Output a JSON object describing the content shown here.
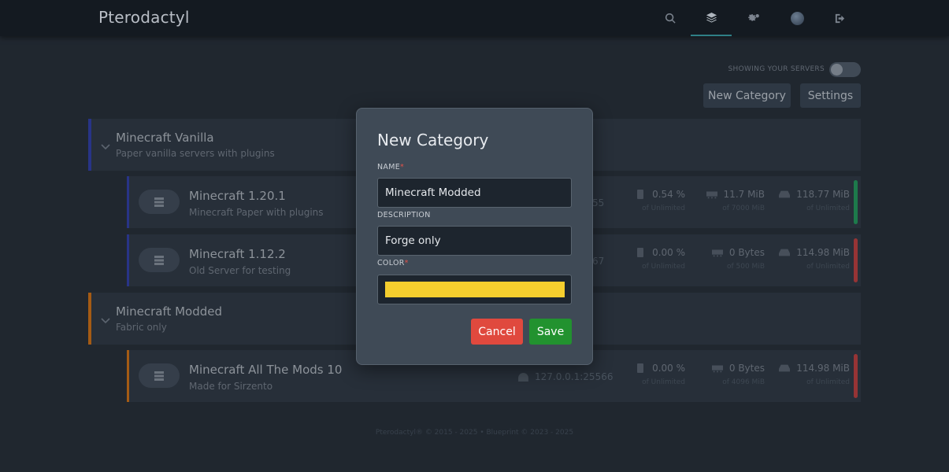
{
  "brand": "Pterodactyl",
  "nav": {
    "icons": [
      "search-icon",
      "layers-icon",
      "cogs-icon",
      "avatar",
      "sign-out-icon"
    ],
    "active": "layers-icon"
  },
  "toolbar": {
    "toggle_label": "SHOWING YOUR SERVERS",
    "toggle_on": false,
    "new_category_label": "New Category",
    "settings_label": "Settings"
  },
  "categories": [
    {
      "name": "Minecraft Vanilla",
      "description": "Paper vanilla servers with plugins",
      "color": "#2c3a9e",
      "servers": [
        {
          "name": "Minecraft 1.20.1",
          "description": "Minecraft Paper with plugins",
          "address_partial": "55",
          "cpu": "0.54 %",
          "cpu_limit": "of Unlimited",
          "memory": "11.7 MiB",
          "memory_limit": "of 7000 MiB",
          "disk": "118.77 MiB",
          "disk_limit": "of Unlimited",
          "status_color": "#1f8f55"
        },
        {
          "name": "Minecraft 1.12.2",
          "description": "Old Server for testing",
          "address_partial": "67",
          "cpu": "0.00 %",
          "cpu_limit": "of Unlimited",
          "memory": "0 Bytes",
          "memory_limit": "of 500 MiB",
          "disk": "114.98 MiB",
          "disk_limit": "of Unlimited",
          "status_color": "#b23a3a"
        }
      ]
    },
    {
      "name": "Minecraft Modded",
      "description": "Fabric only",
      "color": "#c46a12",
      "servers": [
        {
          "name": "Minecraft All The Mods 10",
          "description": "Made for Sirzento",
          "address": "127.0.0.1:25566",
          "cpu": "0.00 %",
          "cpu_limit": "of Unlimited",
          "memory": "0 Bytes",
          "memory_limit": "of 4096 MiB",
          "disk": "114.98 MiB",
          "disk_limit": "of Unlimited",
          "status_color": "#b23a3a"
        }
      ]
    }
  ],
  "footer": "Pterodactyl® © 2015 - 2025  •  Blueprint © 2023 - 2025",
  "modal": {
    "title": "New Category",
    "name_label": "NAME",
    "name_value": "Minecraft Modded",
    "description_label": "DESCRIPTION",
    "description_value": "Forge only",
    "color_label": "COLOR",
    "required_mark": "*",
    "color_value": "#f5ce2e",
    "cancel_label": "Cancel",
    "save_label": "Save",
    "cancel_color": "#e0493e",
    "save_color": "#22922f"
  }
}
